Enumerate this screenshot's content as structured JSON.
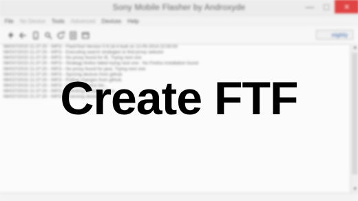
{
  "window": {
    "title": "Sony Mobile Flasher by Androxyde",
    "controls": {
      "minimize_icon": "minimize-icon",
      "maximize_icon": "maximize-icon",
      "close_icon": "close-icon"
    },
    "colors": {
      "close_button": "#e04343"
    }
  },
  "menubar": {
    "items": [
      {
        "label": "File"
      },
      {
        "label": "No Device"
      },
      {
        "label": "Tools"
      },
      {
        "label": "Advanced"
      },
      {
        "label": "Devices"
      },
      {
        "label": "Help"
      }
    ]
  },
  "toolbar": {
    "icons": [
      "flash-icon",
      "back-icon",
      "phone-icon",
      "search-icon",
      "refresh-icon",
      "list-icon",
      "window-icon"
    ],
    "brand_label": "nighly"
  },
  "log": {
    "lines": [
      "08/037/2015 21:37:20 - INFO  - FlashTool Version 0.9.18.4 built on 12-05-2014 22:00:00",
      "08/037/2015 21:37:20 - INFO  - Executing search strategies to find proxy selector",
      "08/037/2015 21:37:20 - INFO  - No proxy found for IE. Trying next one",
      "08/037/2015 21:37:20 - INFO  - Strategy firefox failed trying next one : No Firefox installation found",
      "08/037/2015 21:37:20 - INFO  - No proxy found for java. Trying next one",
      "08/037/2015 21:37:20 - INFO  - Syncing devices from github",
      "08/037/2015 21:37:20 - INFO  - Pulling changes from github.",
      "08/037/2015 21:37:20 - INFO  - Opening device list...",
      "08/037/2015 21:37:20 - INFO  - Checking device root pa...",
      "08/037/2015 21:37:20 - INFO  - Scanning devices..."
    ]
  },
  "overlay": {
    "text": "Create FTF"
  }
}
